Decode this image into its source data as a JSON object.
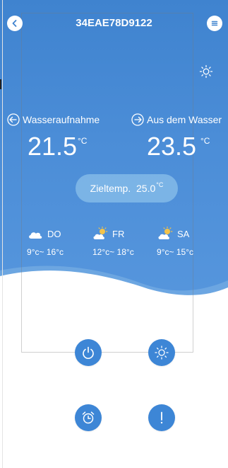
{
  "header": {
    "back_icon": "chevron-left-icon",
    "title": "34EAE78D9122",
    "menu_icon": "menu-icon"
  },
  "mode_icon": "sun-icon",
  "water_in": {
    "label": "Wasseraufnahme",
    "icon": "arrow-in-icon",
    "value": "21.5",
    "unit": "°C"
  },
  "water_out": {
    "label": "Aus dem Wasser",
    "icon": "arrow-out-icon",
    "value": "23.5",
    "unit": "°C"
  },
  "target": {
    "label": "Zieltemp.",
    "value": "25.0",
    "unit": "°C"
  },
  "forecast": [
    {
      "day": "DO",
      "icon": "cloudy-icon",
      "low": "9",
      "high": "16",
      "unit": "°c"
    },
    {
      "day": "FR",
      "icon": "partly-sunny-icon",
      "low": "12",
      "high": "18",
      "unit": "°c"
    },
    {
      "day": "SA",
      "icon": "partly-sunny-icon",
      "low": "9",
      "high": "15",
      "unit": "°c"
    }
  ],
  "range_sep": "~",
  "actions": [
    {
      "name": "power-button",
      "icon": "power-icon"
    },
    {
      "name": "mode-button",
      "icon": "sun-icon"
    },
    {
      "name": "timer-button",
      "icon": "alarm-clock-icon"
    },
    {
      "name": "alert-button",
      "icon": "exclamation-icon"
    }
  ],
  "colors": {
    "hero": "#4a8bd6",
    "button": "#3d86d6",
    "pill": "#a0d2f0"
  }
}
